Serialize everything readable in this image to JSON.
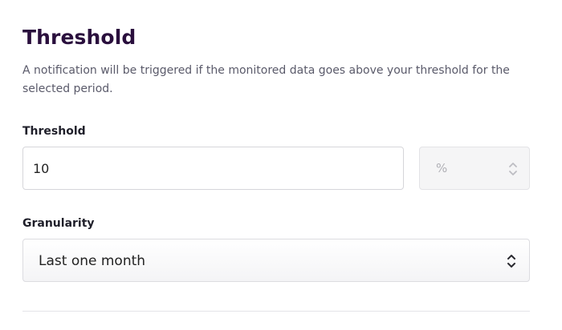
{
  "section": {
    "title": "Threshold",
    "description": "A notification will be triggered if the monitored data goes above your threshold for the selected period."
  },
  "threshold": {
    "label": "Threshold",
    "value": "10",
    "unit": "%",
    "unit_disabled": true
  },
  "granularity": {
    "label": "Granularity",
    "selected": "Last one month"
  },
  "colors": {
    "title": "#2a0f3d",
    "description": "#5a5a6a",
    "disabled_text": "#b0b0b6",
    "border": "#d6d6da"
  },
  "icons": {
    "unit_select": "chevron-up-down-icon",
    "granularity_select": "chevron-up-down-icon"
  }
}
